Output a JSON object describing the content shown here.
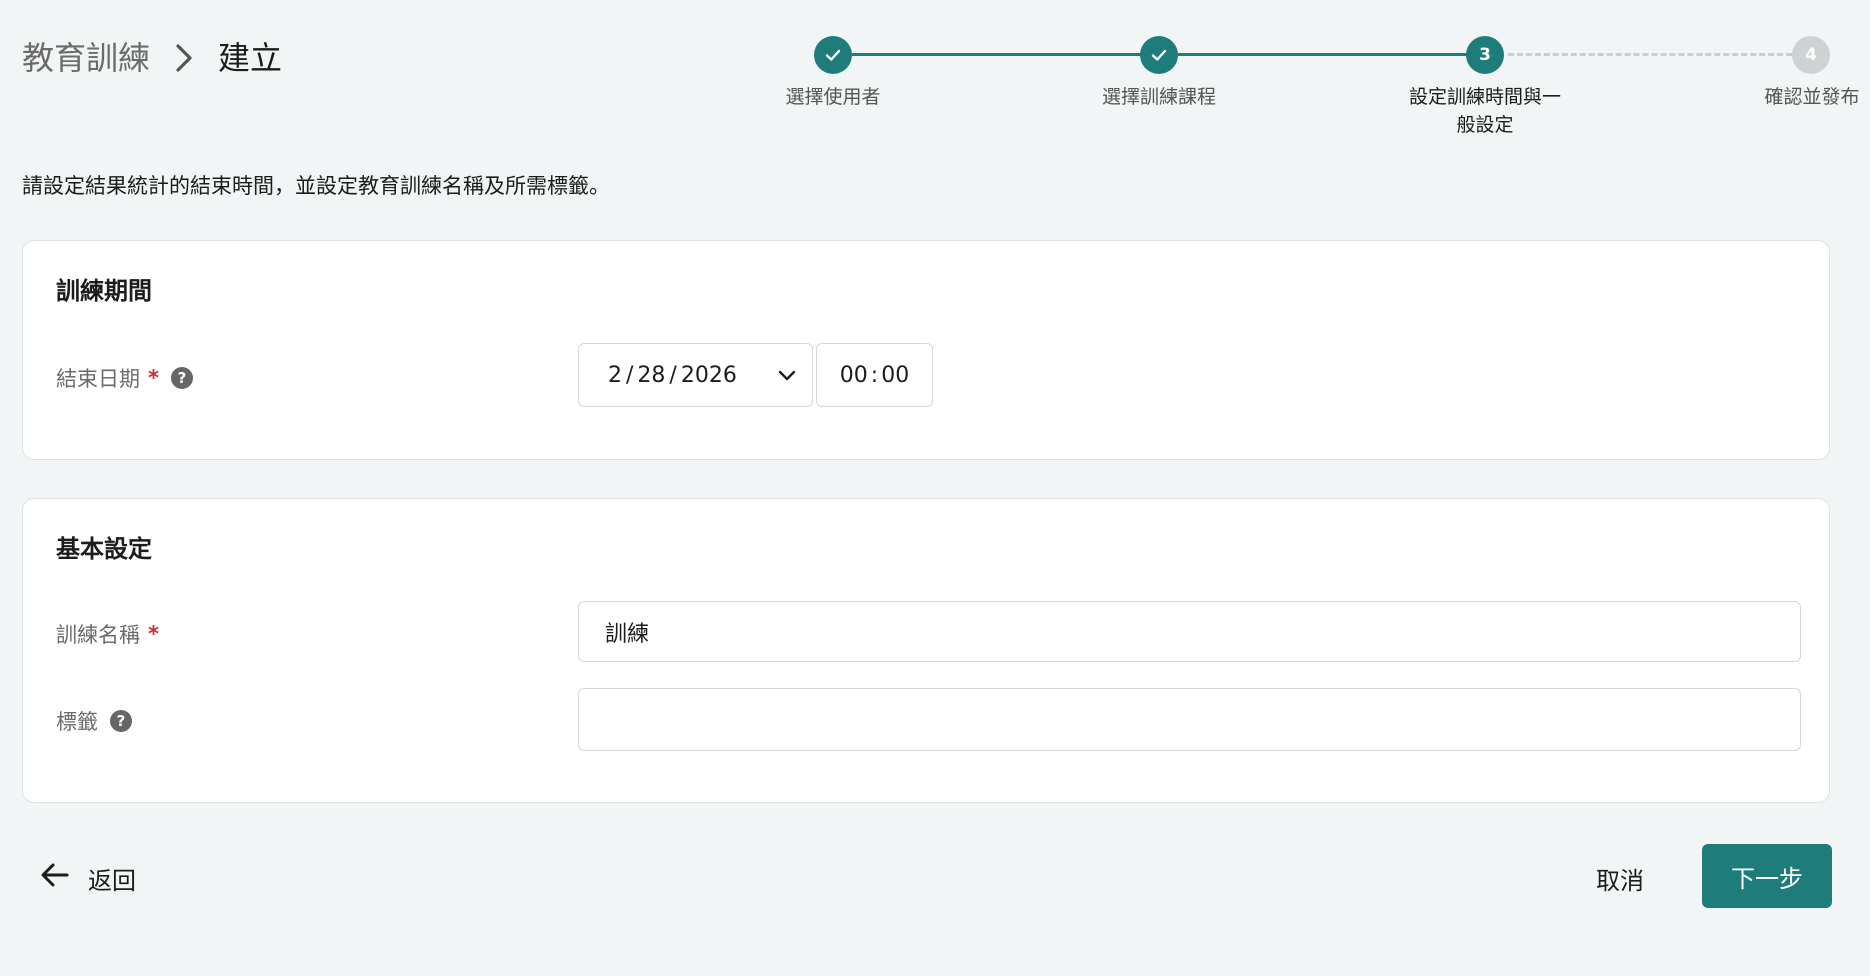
{
  "breadcrumb": {
    "parent": "教育訓練",
    "current": "建立"
  },
  "stepper": {
    "steps": [
      {
        "label": "選擇使用者",
        "status": "done",
        "number": "1"
      },
      {
        "label": "選擇訓練課程",
        "status": "done",
        "number": "2"
      },
      {
        "label": "設定訓練時間與一般設定",
        "status": "active",
        "number": "3"
      },
      {
        "label": "確認並發布",
        "status": "todo",
        "number": "4"
      }
    ],
    "check_icon": "check-icon"
  },
  "instruction": "請設定結果統計的結束時間，並設定教育訓練名稱及所需標籤。",
  "period_card": {
    "title": "訓練期間",
    "end_date_label": "結束日期",
    "required_mark": "*",
    "date_month": "2",
    "date_day": "28",
    "date_year": "2026",
    "date_sep": "/",
    "time_hour": "00",
    "time_minute": "00",
    "time_sep": ":"
  },
  "basic_card": {
    "title": "基本設定",
    "name_label": "訓練名稱",
    "required_mark": "*",
    "name_value": "訓練",
    "tags_label": "標籤",
    "tags_value": ""
  },
  "footer": {
    "back_label": "返回",
    "cancel_label": "取消",
    "next_label": "下一步"
  },
  "colors": {
    "accent": "#1e7d7b",
    "required": "#d0283a",
    "background": "#f2f5f5"
  }
}
